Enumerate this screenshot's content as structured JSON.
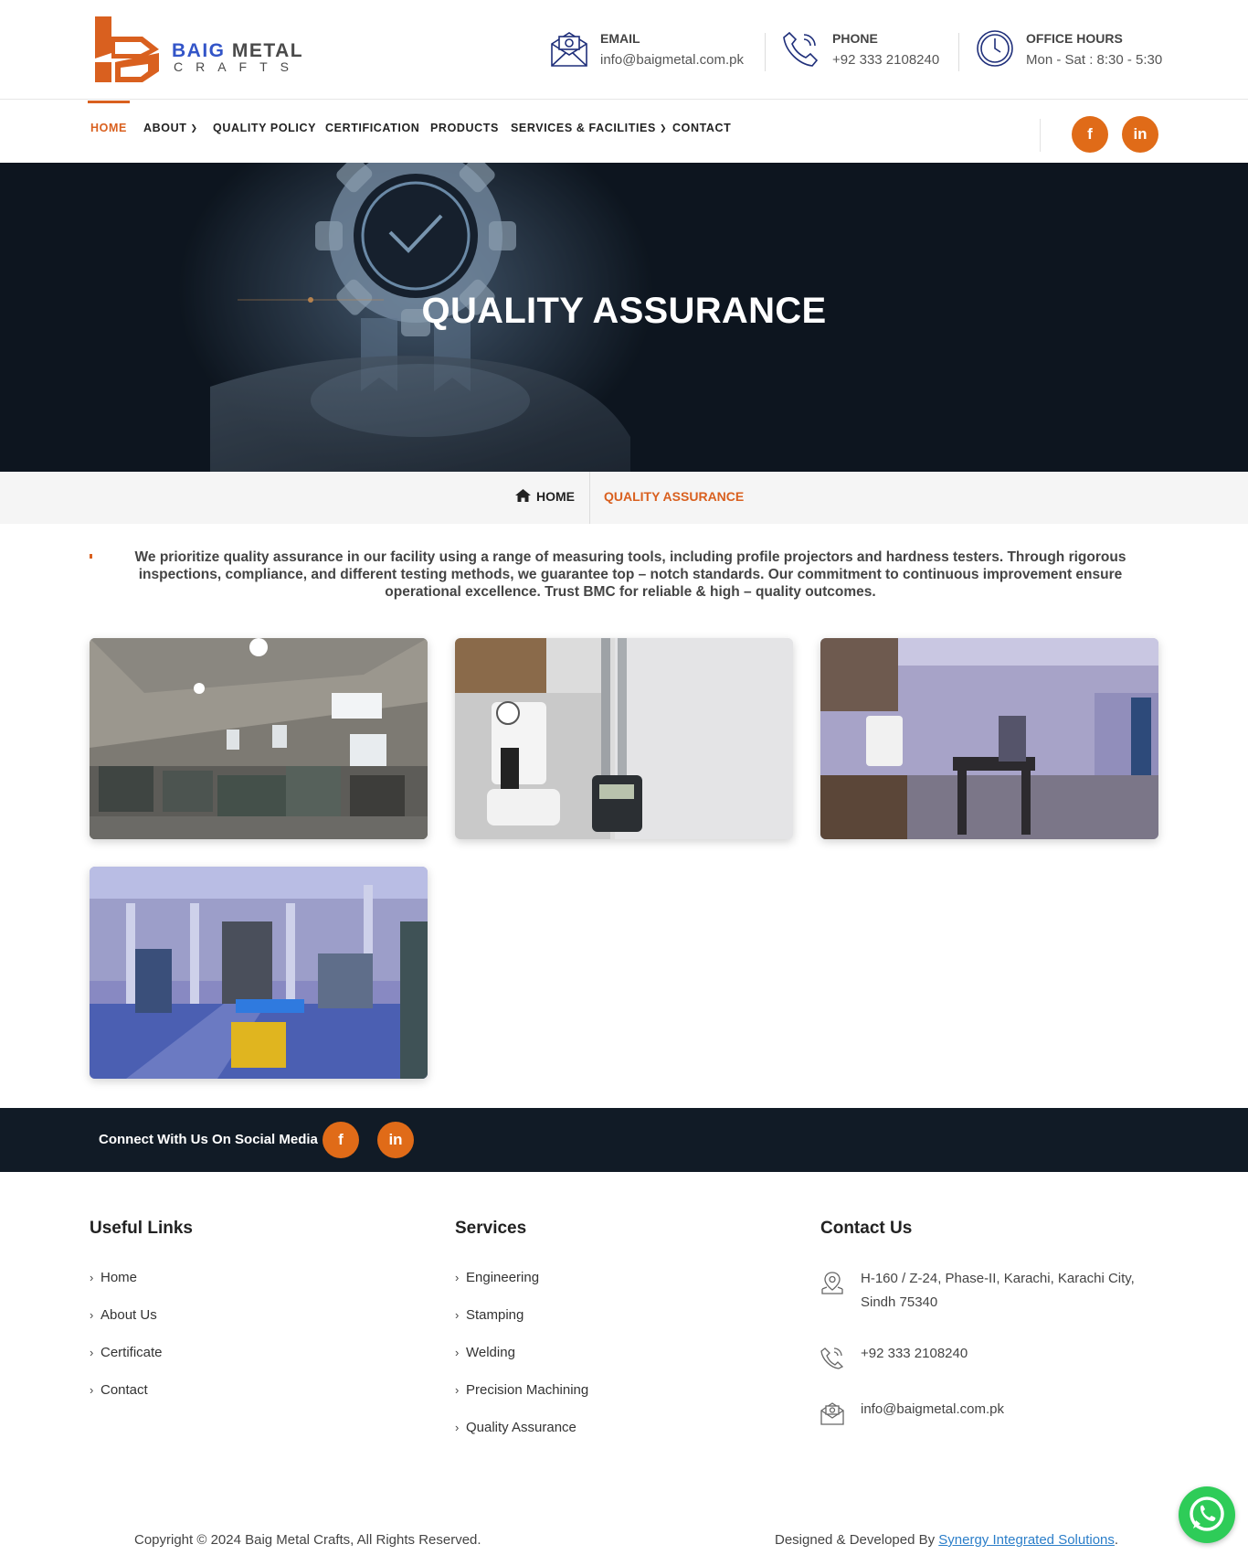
{
  "brand": {
    "name_part1": "BAIG",
    "name_part2": "METAL",
    "name_line2": "CRAFTS",
    "logo_color": "#d9601f"
  },
  "header": {
    "email": {
      "label": "EMAIL",
      "value": "info@baigmetal.com.pk",
      "icon": "envelope-icon"
    },
    "phone": {
      "label": "PHONE",
      "value": "+92 333 2108240",
      "icon": "phone-icon"
    },
    "hours": {
      "label": "OFFICE HOURS",
      "value": "Mon - Sat : 8:30 - 5:30",
      "icon": "clock-icon"
    }
  },
  "nav": {
    "items": [
      {
        "label": "HOME",
        "active": true
      },
      {
        "label": "ABOUT",
        "dropdown": true
      },
      {
        "label": "QUALITY POLICY"
      },
      {
        "label": "CERTIFICATION"
      },
      {
        "label": "PRODUCTS"
      },
      {
        "label": "SERVICES & FACILITIES",
        "dropdown": true
      },
      {
        "label": "CONTACT"
      }
    ],
    "social": [
      {
        "label": "f",
        "icon": "facebook-icon"
      },
      {
        "label": "in",
        "icon": "linkedin-icon"
      }
    ]
  },
  "hero": {
    "title": "QUALITY ASSURANCE"
  },
  "breadcrumb": {
    "home": "HOME",
    "current": "QUALITY ASSURANCE"
  },
  "intro": {
    "text": "We prioritize quality assurance in our facility using a range of measuring tools, including profile projectors and hardness testers. Through rigorous inspections, compliance, and different testing methods, we guarantee top – notch standards. Our commitment to continuous improvement ensure operational excellence. Trust BMC for reliable & high – quality outcomes."
  },
  "gallery": [
    {
      "subject": "workshop-machines"
    },
    {
      "subject": "hardness-tester"
    },
    {
      "subject": "qa-lab-room"
    },
    {
      "subject": "press-shop-floor"
    }
  ],
  "social_strip": {
    "text": "Connect With Us On Social Media",
    "buttons": [
      "f",
      "in"
    ]
  },
  "footer": {
    "useful_links": {
      "title": "Useful Links",
      "items": [
        "Home",
        "About Us",
        "Certificate",
        "Contact"
      ]
    },
    "services": {
      "title": "Services",
      "items": [
        "Engineering",
        "Stamping",
        "Welding",
        "Precision Machining",
        "Quality Assurance"
      ]
    },
    "contact": {
      "title": "Contact Us",
      "address_line1": "H-160 / Z-24, Phase-II, Karachi, Karachi City,",
      "address_line2": "Sindh 75340",
      "phone": "+92 333 2108240",
      "email": "info@baigmetal.com.pk"
    },
    "copyright": "Copyright © 2024 Baig Metal Crafts, All Rights Reserved.",
    "credit_prefix": "Designed & Developed By",
    "credit_link": "Synergy Integrated Solutions",
    "credit_suffix": "."
  },
  "colors": {
    "accent": "#d9601f",
    "social": "#e06b18",
    "dark": "#111b26",
    "whatsapp": "#2ecc58"
  }
}
